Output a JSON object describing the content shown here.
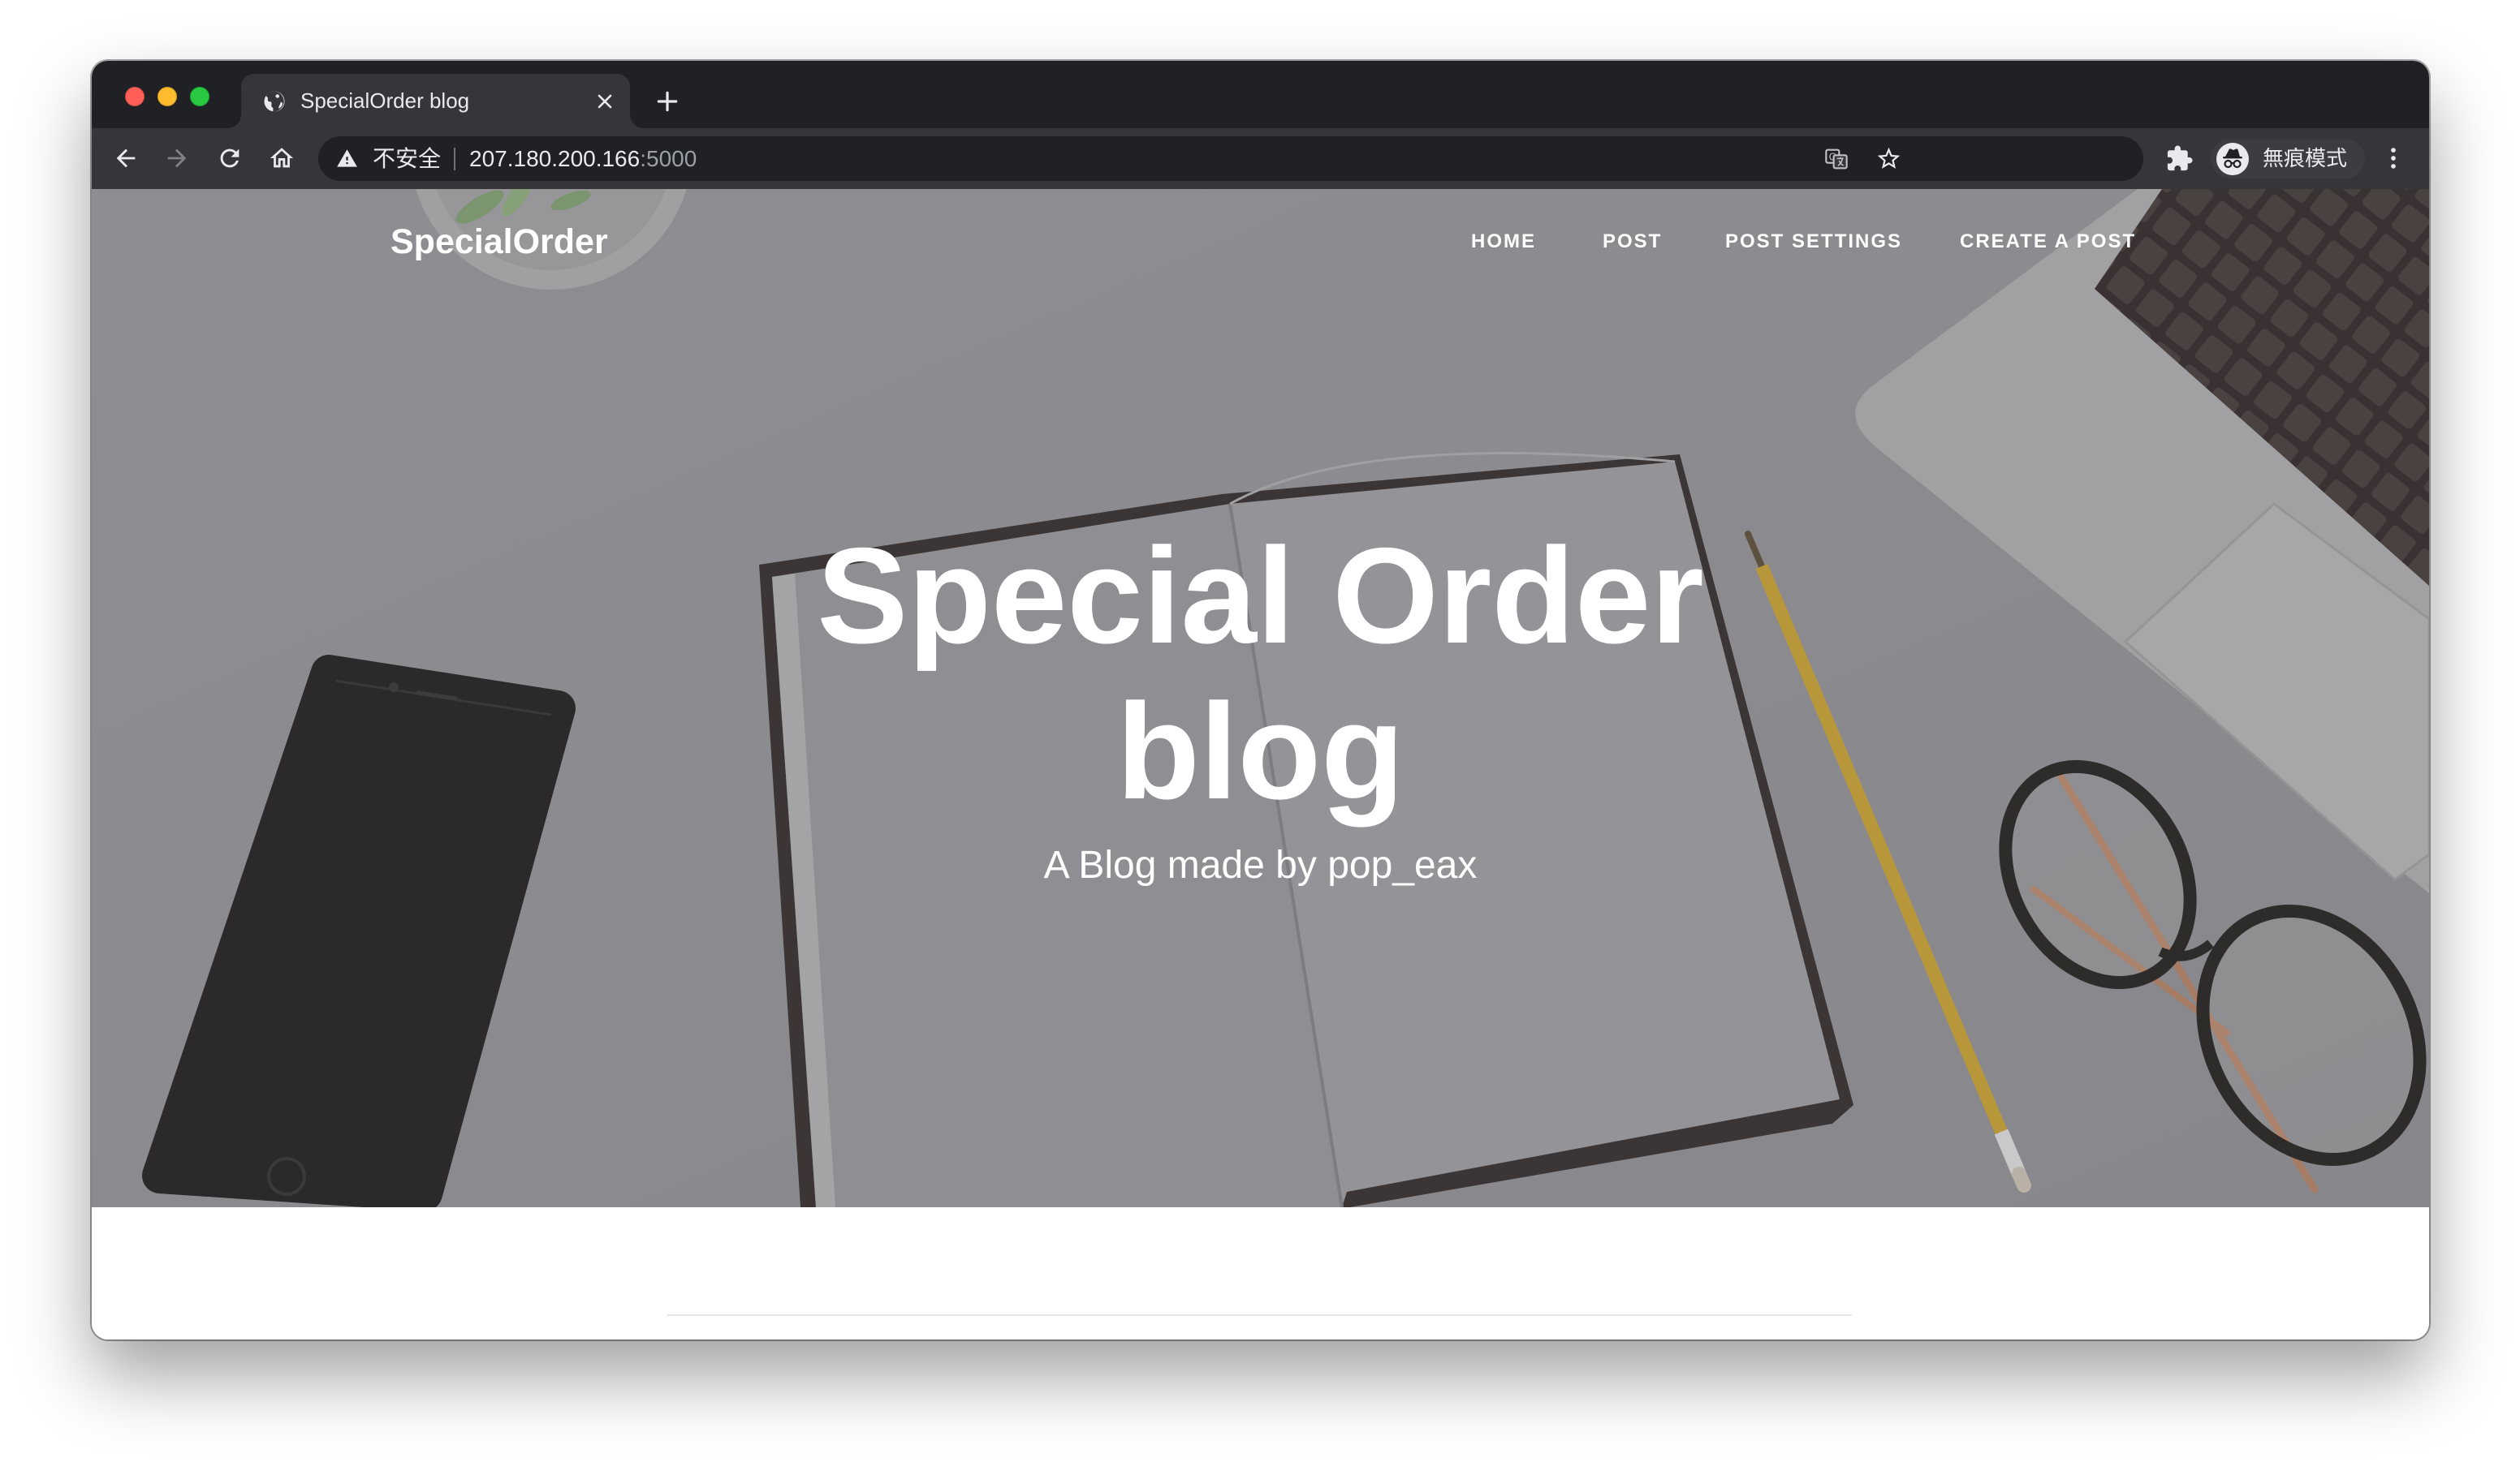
{
  "browser": {
    "traffic_lights": {
      "close_color": "#ff5f57",
      "minimize_color": "#febc2e",
      "zoom_color": "#28c840"
    },
    "tab": {
      "title": "SpecialOrder blog",
      "favicon_icon": "globe-icon",
      "close_icon": "close-icon"
    },
    "new_tab_icon": "plus-icon",
    "toolbar": {
      "back_icon": "arrow-left-icon",
      "forward_icon": "arrow-right-icon",
      "reload_icon": "reload-icon",
      "home_icon": "home-icon"
    },
    "address_bar": {
      "security_icon": "warning-icon",
      "security_label": "不安全",
      "host": "207.180.200.166",
      "port": ":5000",
      "translate_icon": "translate-icon",
      "bookmark_icon": "star-icon"
    },
    "extensions_icon": "puzzle-icon",
    "profile": {
      "icon": "incognito-icon",
      "label": "無痕模式"
    },
    "menu_icon": "more-vert-icon"
  },
  "site": {
    "brand": "SpecialOrder",
    "nav": [
      {
        "label": "HOME"
      },
      {
        "label": "POST"
      },
      {
        "label": "POST SETTINGS"
      },
      {
        "label": "CREATE A POST"
      }
    ],
    "hero": {
      "title": "Special Order blog",
      "subtitle": "A Blog made by pop_eax"
    }
  },
  "colors": {
    "frame": "#202124",
    "toolbar": "#35363a",
    "omnibox": "#202124",
    "browser_text": "#e8eaed",
    "browser_muted_text": "#9aa0a6",
    "hero_overlay": "#8b8b8f",
    "hero_text": "#ffffff",
    "divider": "#e6e6e6"
  }
}
